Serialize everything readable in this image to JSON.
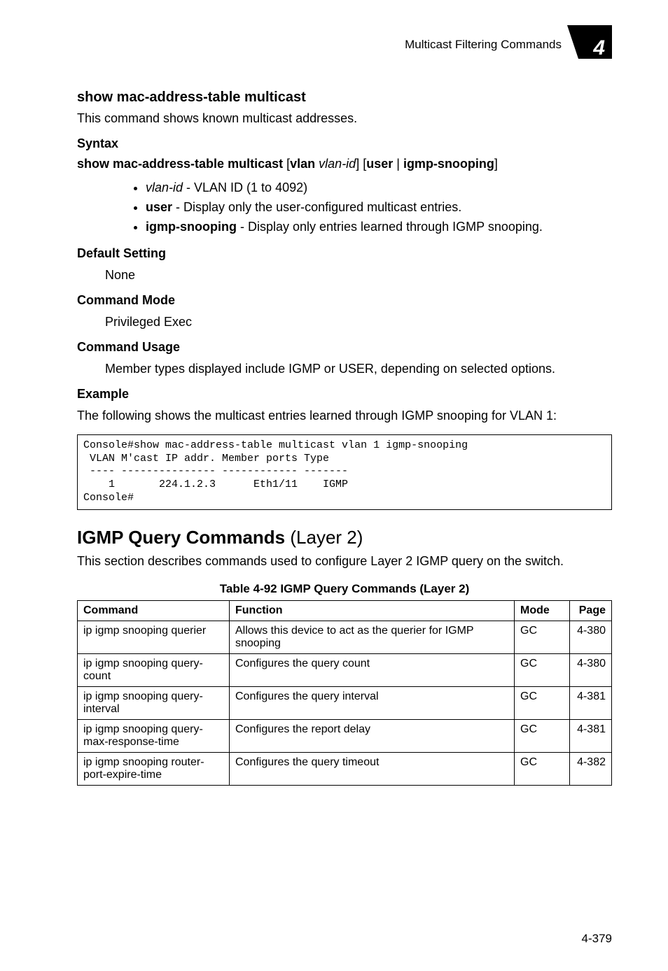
{
  "header": {
    "running_head": "Multicast Filtering Commands",
    "chapter_number": "4"
  },
  "cmd_section": {
    "title": "show mac-address-table multicast",
    "intro": "This command shows known multicast addresses.",
    "syntax_label": "Syntax",
    "syntax_parts": {
      "cmd": "show mac-address-table multicast",
      "lb1": "[",
      "kw_vlan": "vlan",
      "sp1": " ",
      "it_vlanid": "vlan-id",
      "rb1": "] [",
      "kw_user": "user",
      "pipe": " | ",
      "kw_igmp": "igmp-snooping",
      "rb2": "]"
    },
    "bullets": [
      {
        "it": "vlan-id",
        "text": " - VLAN ID (1 to 4092)"
      },
      {
        "kw": "user",
        "text": " - Display only the user-configured multicast entries."
      },
      {
        "kw": "igmp-snooping",
        "text": " - Display only entries learned through IGMP snooping."
      }
    ],
    "default_label": "Default Setting",
    "default_value": "None",
    "mode_label": "Command Mode",
    "mode_value": "Privileged Exec",
    "usage_label": "Command Usage",
    "usage_value": "Member types displayed include IGMP or USER, depending on selected options.",
    "example_label": "Example",
    "example_intro": "The following shows the multicast entries learned through IGMP snooping for VLAN 1:",
    "code": "Console#show mac-address-table multicast vlan 1 igmp-snooping\n VLAN M'cast IP addr. Member ports Type\n ---- --------------- ------------ -------\n    1       224.1.2.3      Eth1/11    IGMP\nConsole#"
  },
  "group_section": {
    "title": "IGMP Query Commands",
    "layer": " (Layer 2)",
    "intro": "This section describes commands used to configure Layer 2 IGMP query on the switch.",
    "table_caption": "Table 4-92   IGMP Query Commands (Layer 2)",
    "headers": {
      "command": "Command",
      "function": "Function",
      "mode": "Mode",
      "page": "Page"
    },
    "rows": [
      {
        "command": "ip igmp snooping querier",
        "function": "Allows this device to act as the querier for IGMP snooping",
        "mode": "GC",
        "page": "4-380"
      },
      {
        "command": "ip igmp snooping query-count",
        "function": "Configures the query count",
        "mode": "GC",
        "page": "4-380"
      },
      {
        "command": "ip igmp snooping query-interval",
        "function": "Configures the query interval",
        "mode": "GC",
        "page": "4-381"
      },
      {
        "command": "ip igmp snooping query-max-response-time",
        "function": "Configures the report delay",
        "mode": "GC",
        "page": "4-381"
      },
      {
        "command": "ip igmp snooping router-port-expire-time",
        "function": "Configures the query timeout",
        "mode": "GC",
        "page": "4-382"
      }
    ]
  },
  "footer": {
    "page_number": "4-379"
  }
}
